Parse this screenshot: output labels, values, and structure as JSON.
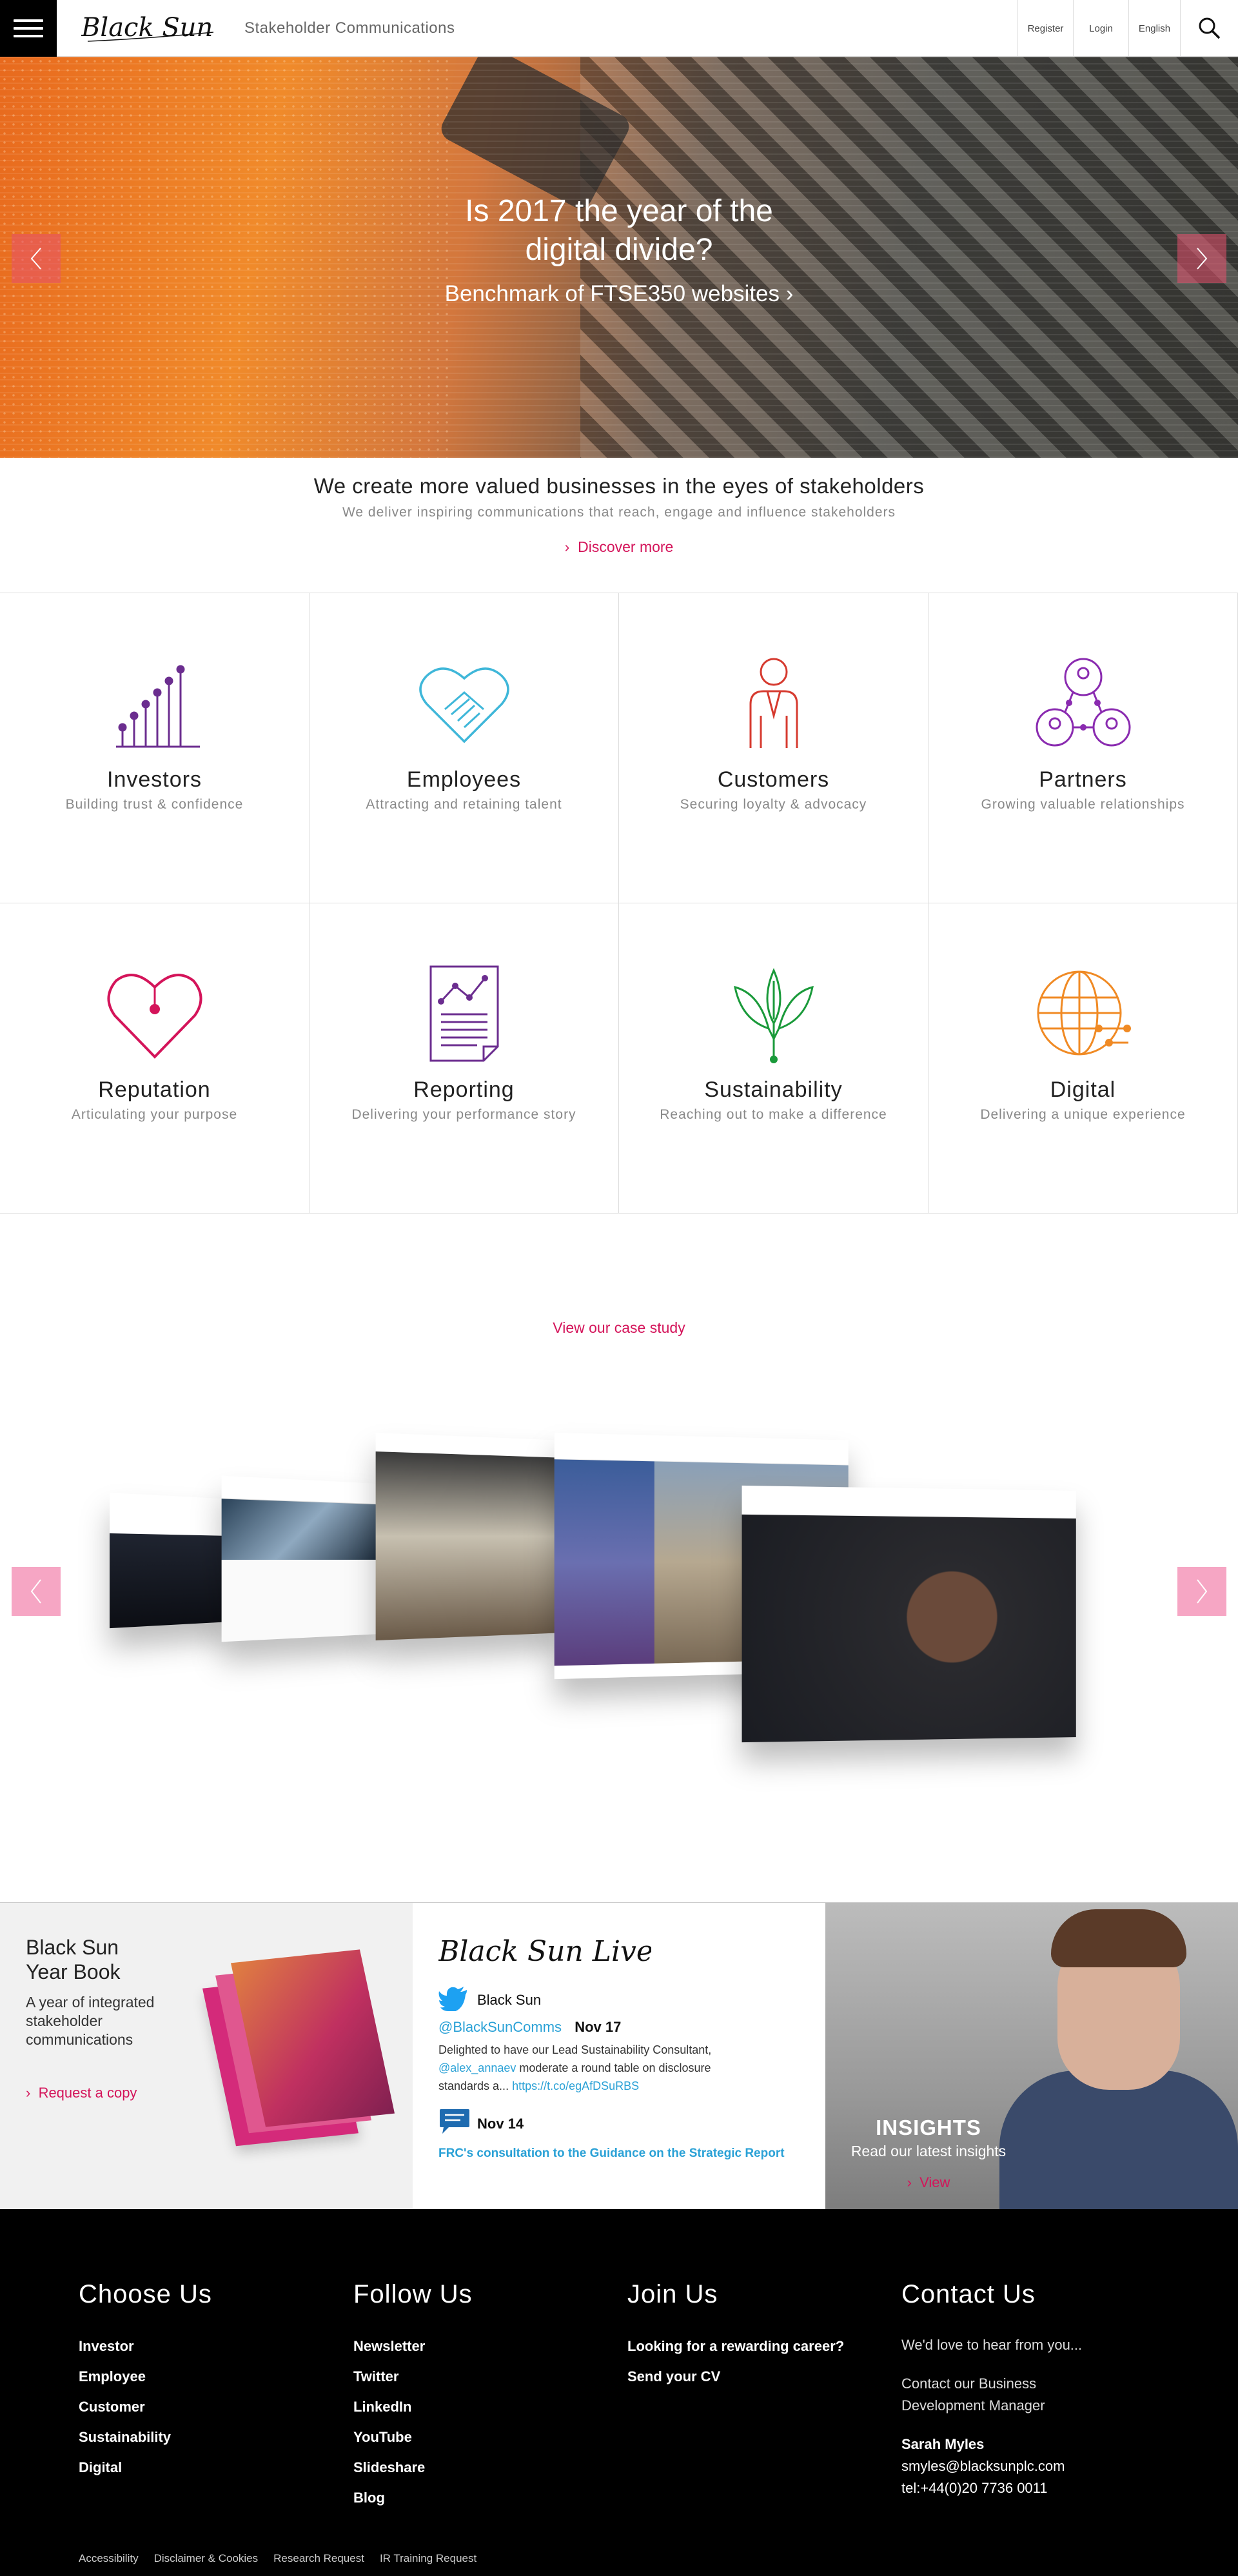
{
  "header": {
    "tagline": "Stakeholder Communications",
    "links": {
      "register": "Register",
      "login": "Login",
      "english": "English"
    },
    "icons": {
      "menu": "hamburger-icon",
      "search": "search-icon"
    }
  },
  "hero": {
    "title_line1": "Is 2017 the year of the",
    "title_line2": "digital divide?",
    "subtitle": "Benchmark of FTSE350 websites ›"
  },
  "intro": {
    "heading": "We create more valued businesses in the eyes of stakeholders",
    "subheading": "We deliver inspiring communications that reach, engage and influence stakeholders",
    "link": "Discover more"
  },
  "services": [
    {
      "title": "Investors",
      "subtitle": "Building trust & confidence",
      "color": "#6b2d8f"
    },
    {
      "title": "Employees",
      "subtitle": "Attracting and retaining talent",
      "color": "#3fb7d9"
    },
    {
      "title": "Customers",
      "subtitle": "Securing loyalty & advocacy",
      "color": "#d63a2f"
    },
    {
      "title": "Partners",
      "subtitle": "Growing valuable relationships",
      "color": "#8a2bb0"
    },
    {
      "title": "Reputation",
      "subtitle": "Articulating your purpose",
      "color": "#d4145a"
    },
    {
      "title": "Reporting",
      "subtitle": "Delivering your performance story",
      "color": "#6b2d8f"
    },
    {
      "title": "Sustainability",
      "subtitle": "Reaching out to make a difference",
      "color": "#1a9a3a"
    },
    {
      "title": "Digital",
      "subtitle": "Delivering a unique experience",
      "color": "#f08a24"
    }
  ],
  "case_study": {
    "link": "View our case study"
  },
  "yearbook": {
    "title_line1": "Black Sun",
    "title_line2": "Year Book",
    "description": "A year of integrated stakeholder communications",
    "link": "Request a copy"
  },
  "live": {
    "twitter_name": "Black Sun",
    "twitter_handle": "@BlackSunComms",
    "tweet_date": "Nov 17",
    "tweet_text_1": "Delighted to have our Lead Sustainability Consultant,",
    "tweet_mention": "@alex_annaev",
    "tweet_text_2": "moderate a round table on disclosure",
    "tweet_text_3": "standards a...",
    "tweet_link": "https://t.co/egAfDSuRBS",
    "blog_date": "Nov 14",
    "blog_title": "FRC's consultation to the Guidance on the Strategic Report"
  },
  "insights": {
    "title": "INSIGHTS",
    "subtitle": "Read our latest insights",
    "link": "View"
  },
  "footer": {
    "choose": {
      "title": "Choose Us",
      "items": [
        "Investor",
        "Employee",
        "Customer",
        "Sustainability",
        "Digital"
      ]
    },
    "follow": {
      "title": "Follow Us",
      "items": [
        "Newsletter",
        "Twitter",
        "LinkedIn",
        "YouTube",
        "Slideshare",
        "Blog"
      ]
    },
    "join": {
      "title": "Join Us",
      "items": [
        "Looking for a rewarding career?",
        "Send your CV"
      ]
    },
    "contact": {
      "title": "Contact Us",
      "intro": "We'd love to hear from you...",
      "business_line1": "Contact our Business",
      "business_line2": "Development Manager",
      "name": "Sarah Myles",
      "email": "smyles@blacksunplc.com",
      "phone": "tel:+44(0)20 7736 0011"
    },
    "bottom_links": [
      "Accessibility",
      "Disclaimer & Cookies",
      "Research Request",
      "IR Training Request"
    ]
  }
}
